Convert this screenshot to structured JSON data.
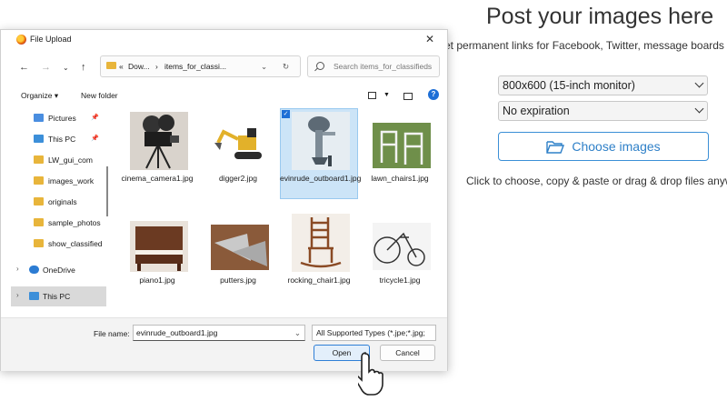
{
  "page": {
    "title": "Post your images here",
    "subtitle": "et permanent links for Facebook, Twitter, message boards a",
    "resolution_select": "800x600 (15-inch monitor)",
    "expiration_select": "No expiration",
    "choose_button": "Choose images",
    "hint": "Click to choose, copy & paste or drag & drop files anywh"
  },
  "dialog": {
    "title": "File Upload",
    "address": {
      "prefix": "«",
      "segment1": "Dow...",
      "sep": "›",
      "segment2": "items_for_classi..."
    },
    "search_placeholder": "Search items_for_classifieds",
    "organize": "Organize ▾",
    "new_folder": "New folder",
    "sidebar": [
      {
        "label": "Pictures",
        "icon": "pictures-folder-icon",
        "pinned": true
      },
      {
        "label": "This PC",
        "icon": "pc-icon",
        "pinned": true
      },
      {
        "label": "LW_gui_com",
        "icon": "folder-icon",
        "pinned": false
      },
      {
        "label": "images_work",
        "icon": "folder-icon",
        "pinned": false
      },
      {
        "label": "originals",
        "icon": "folder-icon",
        "pinned": false
      },
      {
        "label": "sample_photos",
        "icon": "folder-icon",
        "pinned": false
      },
      {
        "label": "show_classified",
        "icon": "folder-icon",
        "pinned": false
      },
      {
        "label": "OneDrive",
        "icon": "cloud-icon",
        "pinned": false
      },
      {
        "label": "This PC",
        "icon": "pc-icon",
        "pinned": false
      }
    ],
    "files": [
      {
        "name": "cinema_camera1.jpg",
        "selected": false
      },
      {
        "name": "digger2.jpg",
        "selected": false
      },
      {
        "name": "evinrude_outboard1.jpg",
        "selected": true
      },
      {
        "name": "lawn_chairs1.jpg",
        "selected": false
      },
      {
        "name": "piano1.jpg",
        "selected": false
      },
      {
        "name": "putters.jpg",
        "selected": false
      },
      {
        "name": "rocking_chair1.jpg",
        "selected": false
      },
      {
        "name": "tricycle1.jpg",
        "selected": false
      }
    ],
    "file_name_label": "File name:",
    "file_name_value": "evinrude_outboard1.jpg",
    "file_type": "All Supported Types (*.jpe;*.jpg;",
    "open_button": "Open",
    "cancel_button": "Cancel"
  },
  "colors": {
    "accent": "#2f80c8",
    "selection": "#cce4f7",
    "folder": "#e8b53b"
  }
}
